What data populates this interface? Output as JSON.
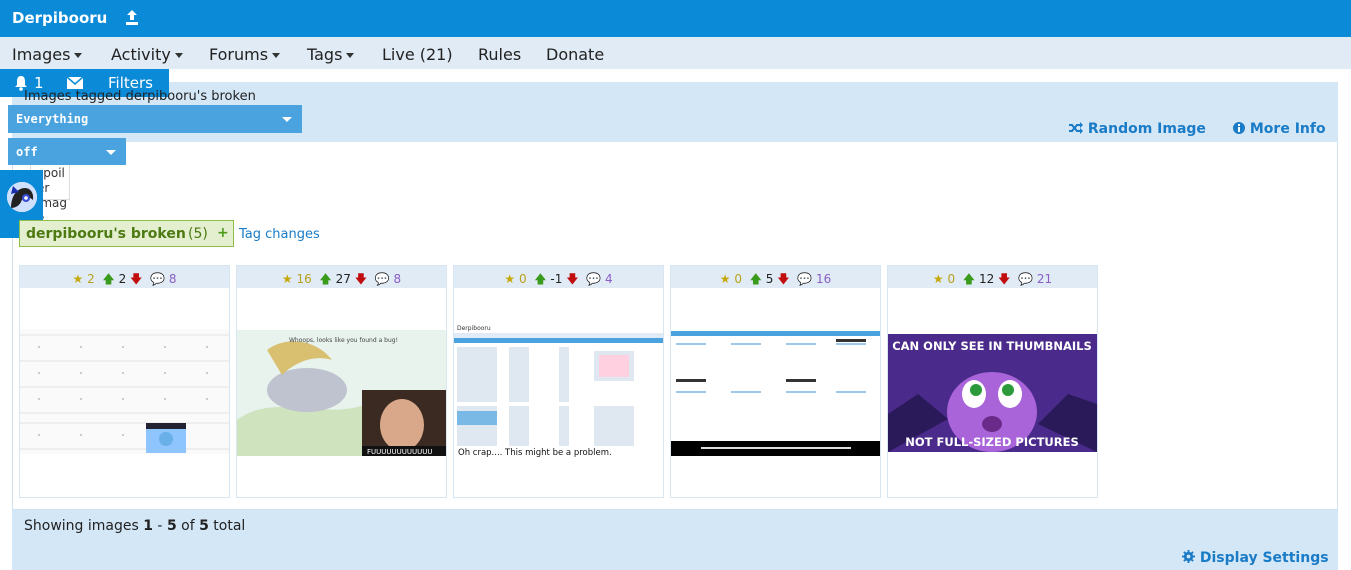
{
  "app": {
    "title": "Derpibooru"
  },
  "nav": {
    "items": [
      {
        "label": "Images",
        "dropdown": true
      },
      {
        "label": "Activity",
        "dropdown": true
      },
      {
        "label": "Forums",
        "dropdown": true
      },
      {
        "label": "Tags",
        "dropdown": true
      },
      {
        "label": "Live (21)",
        "dropdown": false
      },
      {
        "label": "Rules",
        "dropdown": false
      },
      {
        "label": "Donate",
        "dropdown": false
      }
    ]
  },
  "userbar": {
    "notifications": "1",
    "filters_label": "Filters"
  },
  "header": {
    "title": "Images tagged derpibooru's broken",
    "filter_select": "Everything",
    "spoiler_select": "off",
    "random_image": "Random Image",
    "more_info": "More Info"
  },
  "spoiler_alt": "no spoiler image",
  "tag": {
    "name": "derpibooru's broken",
    "count": "(5)",
    "plus": "+",
    "changes_link": "Tag changes"
  },
  "cards": [
    {
      "faves": "2",
      "score": "2",
      "comments": "8"
    },
    {
      "faves": "16",
      "score": "27",
      "comments": "8"
    },
    {
      "faves": "0",
      "score": "-1",
      "comments": "4"
    },
    {
      "faves": "0",
      "score": "5",
      "comments": "16"
    },
    {
      "faves": "0",
      "score": "12",
      "comments": "21"
    }
  ],
  "thumbs": {
    "t2_caption_top": "Whoops, looks like you found a bug!",
    "t2_caption_bottom": "FUUUUUUUUUUUU",
    "t3_site": "Derpibooru",
    "t3_caption": "Oh crap.... This might be a problem.",
    "t5_top": "CAN ONLY SEE IN THUMBNAILS",
    "t5_bottom": "NOT FULL-SIZED PICTURES"
  },
  "footer": {
    "showing_prefix": "Showing images ",
    "from": "1",
    "dash": " - ",
    "to": "5",
    "of": " of ",
    "total": "5",
    "suffix": " total",
    "display_settings": "Display Settings"
  },
  "colors": {
    "brand": "#0a8ad7",
    "nav_bg": "#e0ebf5",
    "panel": "#d4e7f7",
    "link": "#1a7bc7"
  }
}
